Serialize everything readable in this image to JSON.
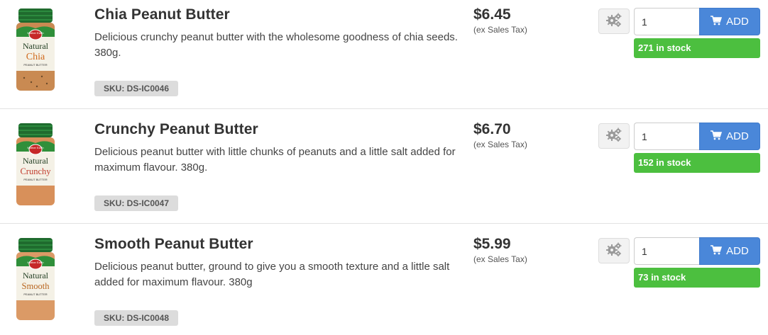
{
  "colors": {
    "add_button": "#4a87d9",
    "stock_badge": "#4cbf3f",
    "sku_badge": "#dcdcdc",
    "jar_lid": "#1f6b2e",
    "jar_body": "#d99a67"
  },
  "icons": {
    "options": "gears-icon",
    "cart": "cart-icon"
  },
  "products": [
    {
      "name": "Chia Peanut Butter",
      "description": "Delicious crunchy peanut butter with the wholesome goodness of chia seeds. 380g.",
      "sku": "SKU: DS-IC0046",
      "price": "$6.45",
      "tax_note": "(ex Sales Tax)",
      "quantity": "1",
      "add_label": "ADD",
      "stock": "271 in stock",
      "jar_brand": "Mother Earth",
      "jar_line1": "Natural",
      "jar_line2": "Chia",
      "jar_line3": "PEANUT BUTTER",
      "jar_color": "#c98a52",
      "jar_text_color": "#d06a1d"
    },
    {
      "name": "Crunchy Peanut Butter",
      "description": "Delicious peanut butter with little chunks of peanuts and a little salt added for maximum flavour. 380g.",
      "sku": "SKU: DS-IC0047",
      "price": "$6.70",
      "tax_note": "(ex Sales Tax)",
      "quantity": "1",
      "add_label": "ADD",
      "stock": "152 in stock",
      "jar_brand": "Mother Earth",
      "jar_line1": "Natural",
      "jar_line2": "Crunchy",
      "jar_line3": "PEANUT BUTTER",
      "jar_color": "#d8905a",
      "jar_text_color": "#c0392b"
    },
    {
      "name": "Smooth Peanut Butter",
      "description": "Delicious peanut butter, ground to give you a smooth texture and a little salt added for maximum flavour. 380g",
      "sku": "SKU: DS-IC0048",
      "price": "$5.99",
      "tax_note": "(ex Sales Tax)",
      "quantity": "1",
      "add_label": "ADD",
      "stock": "73 in stock",
      "jar_brand": "Mother Earth",
      "jar_line1": "Natural",
      "jar_line2": "Smooth",
      "jar_line3": "PEANUT BUTTER",
      "jar_color": "#db9a66",
      "jar_text_color": "#b8651e"
    }
  ]
}
